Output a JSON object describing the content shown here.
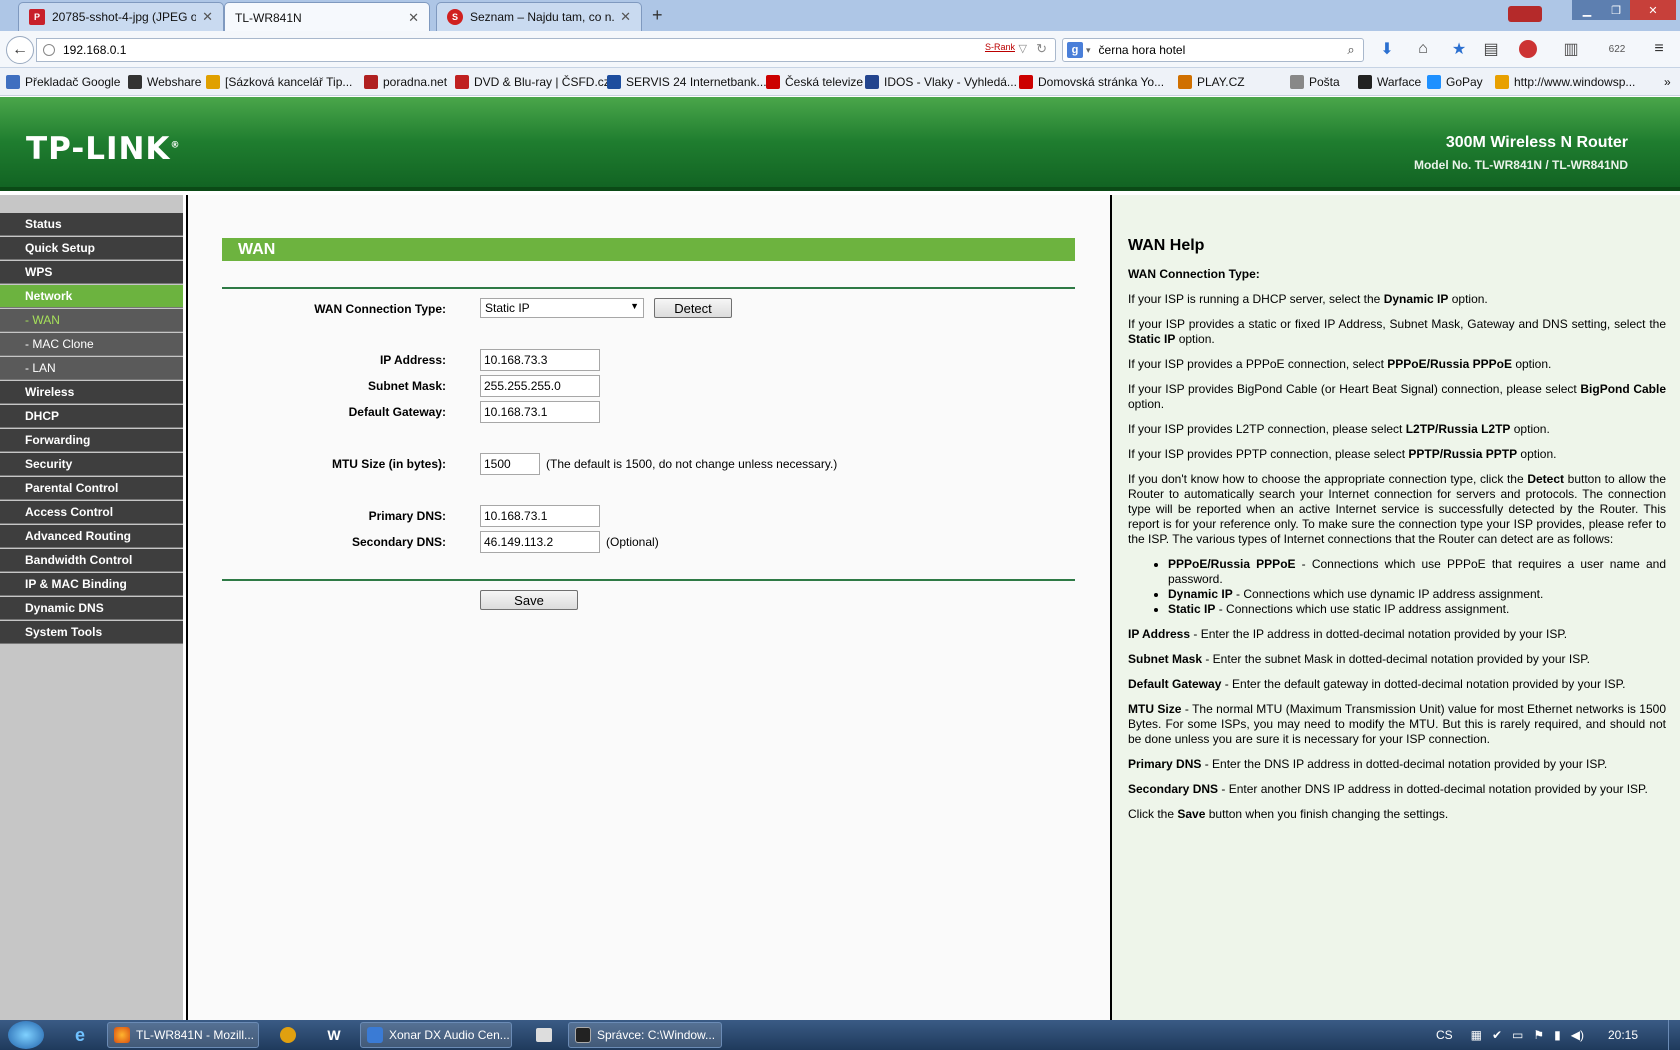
{
  "browser": {
    "tabs": [
      {
        "label": "20785-sshot-4-jpg (JPEG o...",
        "active": false,
        "icon": "image-favicon"
      },
      {
        "label": "TL-WR841N",
        "active": true,
        "icon": ""
      },
      {
        "label": "Seznam – Najdu tam, co n...",
        "active": false,
        "icon": "seznam-favicon"
      }
    ],
    "new_tab": "+",
    "url": "192.168.0.1",
    "srank": "S-Rank",
    "search_query": "černa hora  hotel",
    "email_count": "622"
  },
  "bookmarks": [
    {
      "label": "Překladač Google",
      "color": "#3f6fc0"
    },
    {
      "label": "Webshare",
      "color": "#333"
    },
    {
      "label": "[Sázková kancelář Tip...",
      "color": "#e0a000"
    },
    {
      "label": "poradna.net",
      "color": "#b02020"
    },
    {
      "label": "DVD & Blu-ray | ČSFD.cz",
      "color": "#c02020"
    },
    {
      "label": "SERVIS 24 Internetbank...",
      "color": "#1d4d9e"
    },
    {
      "label": "Česká televize",
      "color": "#c00"
    },
    {
      "label": "IDOS - Vlaky - Vyhledá...",
      "color": "#23448e"
    },
    {
      "label": "Domovská stránka Yo...",
      "color": "#c00"
    },
    {
      "label": "PLAY.CZ",
      "color": "#d07000"
    },
    {
      "label": "Pošta",
      "color": "#888"
    },
    {
      "label": "Warface",
      "color": "#222"
    },
    {
      "label": "GoPay",
      "color": "#1e90ff"
    },
    {
      "label": "http://www.windowsp...",
      "color": "#e8a000"
    }
  ],
  "router": {
    "logo": "TP-LINK",
    "product": "300M Wireless N Router",
    "model": "Model No. TL-WR841N / TL-WR841ND"
  },
  "menu": [
    {
      "label": "Status",
      "type": "main"
    },
    {
      "label": "Quick Setup",
      "type": "main"
    },
    {
      "label": "WPS",
      "type": "main"
    },
    {
      "label": "Network",
      "type": "active"
    },
    {
      "label": "- WAN",
      "type": "subactive"
    },
    {
      "label": "- MAC Clone",
      "type": "sub"
    },
    {
      "label": "- LAN",
      "type": "sub"
    },
    {
      "label": "Wireless",
      "type": "main"
    },
    {
      "label": "DHCP",
      "type": "main"
    },
    {
      "label": "Forwarding",
      "type": "main"
    },
    {
      "label": "Security",
      "type": "main"
    },
    {
      "label": "Parental Control",
      "type": "main"
    },
    {
      "label": "Access Control",
      "type": "main"
    },
    {
      "label": "Advanced Routing",
      "type": "main"
    },
    {
      "label": "Bandwidth Control",
      "type": "main"
    },
    {
      "label": "IP & MAC Binding",
      "type": "main"
    },
    {
      "label": "Dynamic DNS",
      "type": "main"
    },
    {
      "label": "System Tools",
      "type": "main"
    }
  ],
  "wan": {
    "title": "WAN",
    "conn_type_label": "WAN Connection Type:",
    "conn_type_value": "Static IP",
    "detect_label": "Detect",
    "ip_label": "IP Address:",
    "ip_value": "10.168.73.3",
    "mask_label": "Subnet Mask:",
    "mask_value": "255.255.255.0",
    "gateway_label": "Default Gateway:",
    "gateway_value": "10.168.73.1",
    "mtu_label": "MTU Size (in bytes):",
    "mtu_value": "1500",
    "mtu_hint": "(The default is 1500, do not change unless necessary.)",
    "dns1_label": "Primary DNS:",
    "dns1_value": "10.168.73.1",
    "dns2_label": "Secondary DNS:",
    "dns2_value": "46.149.113.2",
    "dns2_hint": "(Optional)",
    "save_label": "Save"
  },
  "help": {
    "title": "WAN Help",
    "subtitle": "WAN Connection Type:",
    "p_dhcp_a": "If your ISP is running a DHCP server, select the ",
    "p_dhcp_b": "Dynamic IP",
    "p_dhcp_c": " option.",
    "p_static_a": "If your ISP provides a static or fixed IP Address, Subnet Mask, Gateway and DNS setting, select the ",
    "p_static_b": "Static IP",
    "p_static_c": " option.",
    "p_pppoe_a": "If your ISP provides a PPPoE connection, select ",
    "p_pppoe_b": "PPPoE/Russia PPPoE",
    "p_pppoe_c": " option.",
    "p_bigpond_a": "If your ISP provides BigPond Cable (or Heart Beat Signal) connection, please select ",
    "p_bigpond_b": "BigPond Cable",
    "p_bigpond_c": " option.",
    "p_l2tp_a": "If your ISP provides L2TP connection, please select ",
    "p_l2tp_b": "L2TP/Russia L2TP",
    "p_l2tp_c": " option.",
    "p_pptp_a": "If your ISP provides PPTP connection, please select ",
    "p_pptp_b": "PPTP/Russia PPTP",
    "p_pptp_c": " option.",
    "p_detect_a": "If you don't know how to choose the appropriate connection type, click the ",
    "p_detect_b": "Detect",
    "p_detect_c": " button to allow the Router to automatically search your Internet connection for servers and protocols. The connection type will be reported when an active Internet service is successfully detected by the Router. This report is for your reference only. To make sure the connection type your ISP provides, please refer to the ISP. The various types of Internet connections that the Router can detect are as follows:",
    "li1_a": "PPPoE/Russia PPPoE",
    "li1_b": " - Connections which use PPPoE that requires a user name and password.",
    "li2_a": "Dynamic IP",
    "li2_b": " - Connections which use dynamic IP address assignment.",
    "li3_a": "Static IP",
    "li3_b": " - Connections which use static IP address assignment.",
    "ip_a": "IP Address",
    "ip_b": " - Enter the IP address in dotted-decimal notation provided by your ISP.",
    "mask_a": "Subnet Mask",
    "mask_b": " - Enter the subnet Mask in dotted-decimal notation provided by your ISP.",
    "gw_a": "Default Gateway",
    "gw_b": " - Enter the default gateway in dotted-decimal notation provided by your ISP.",
    "mtu_a": "MTU Size",
    "mtu_b": " - The normal MTU (Maximum Transmission Unit) value for most Ethernet networks is 1500 Bytes. For some ISPs, you may need to modify the MTU. But this is rarely required, and should not be done unless you are sure it is necessary for your ISP connection.",
    "dns1_a": "Primary DNS",
    "dns1_b": " - Enter the DNS IP address in dotted-decimal notation provided by your ISP.",
    "dns2_a": "Secondary DNS",
    "dns2_b": " - Enter another DNS IP address in dotted-decimal notation provided by your ISP.",
    "save_a": "Click the ",
    "save_b": "Save",
    "save_c": " button when you finish changing the settings."
  },
  "taskbar": {
    "tasks": [
      "TL-WR841N - Mozill...",
      "Xonar DX Audio Cen...",
      "Správce: C:\\Window..."
    ],
    "lang": "CS",
    "time": "20:15"
  }
}
